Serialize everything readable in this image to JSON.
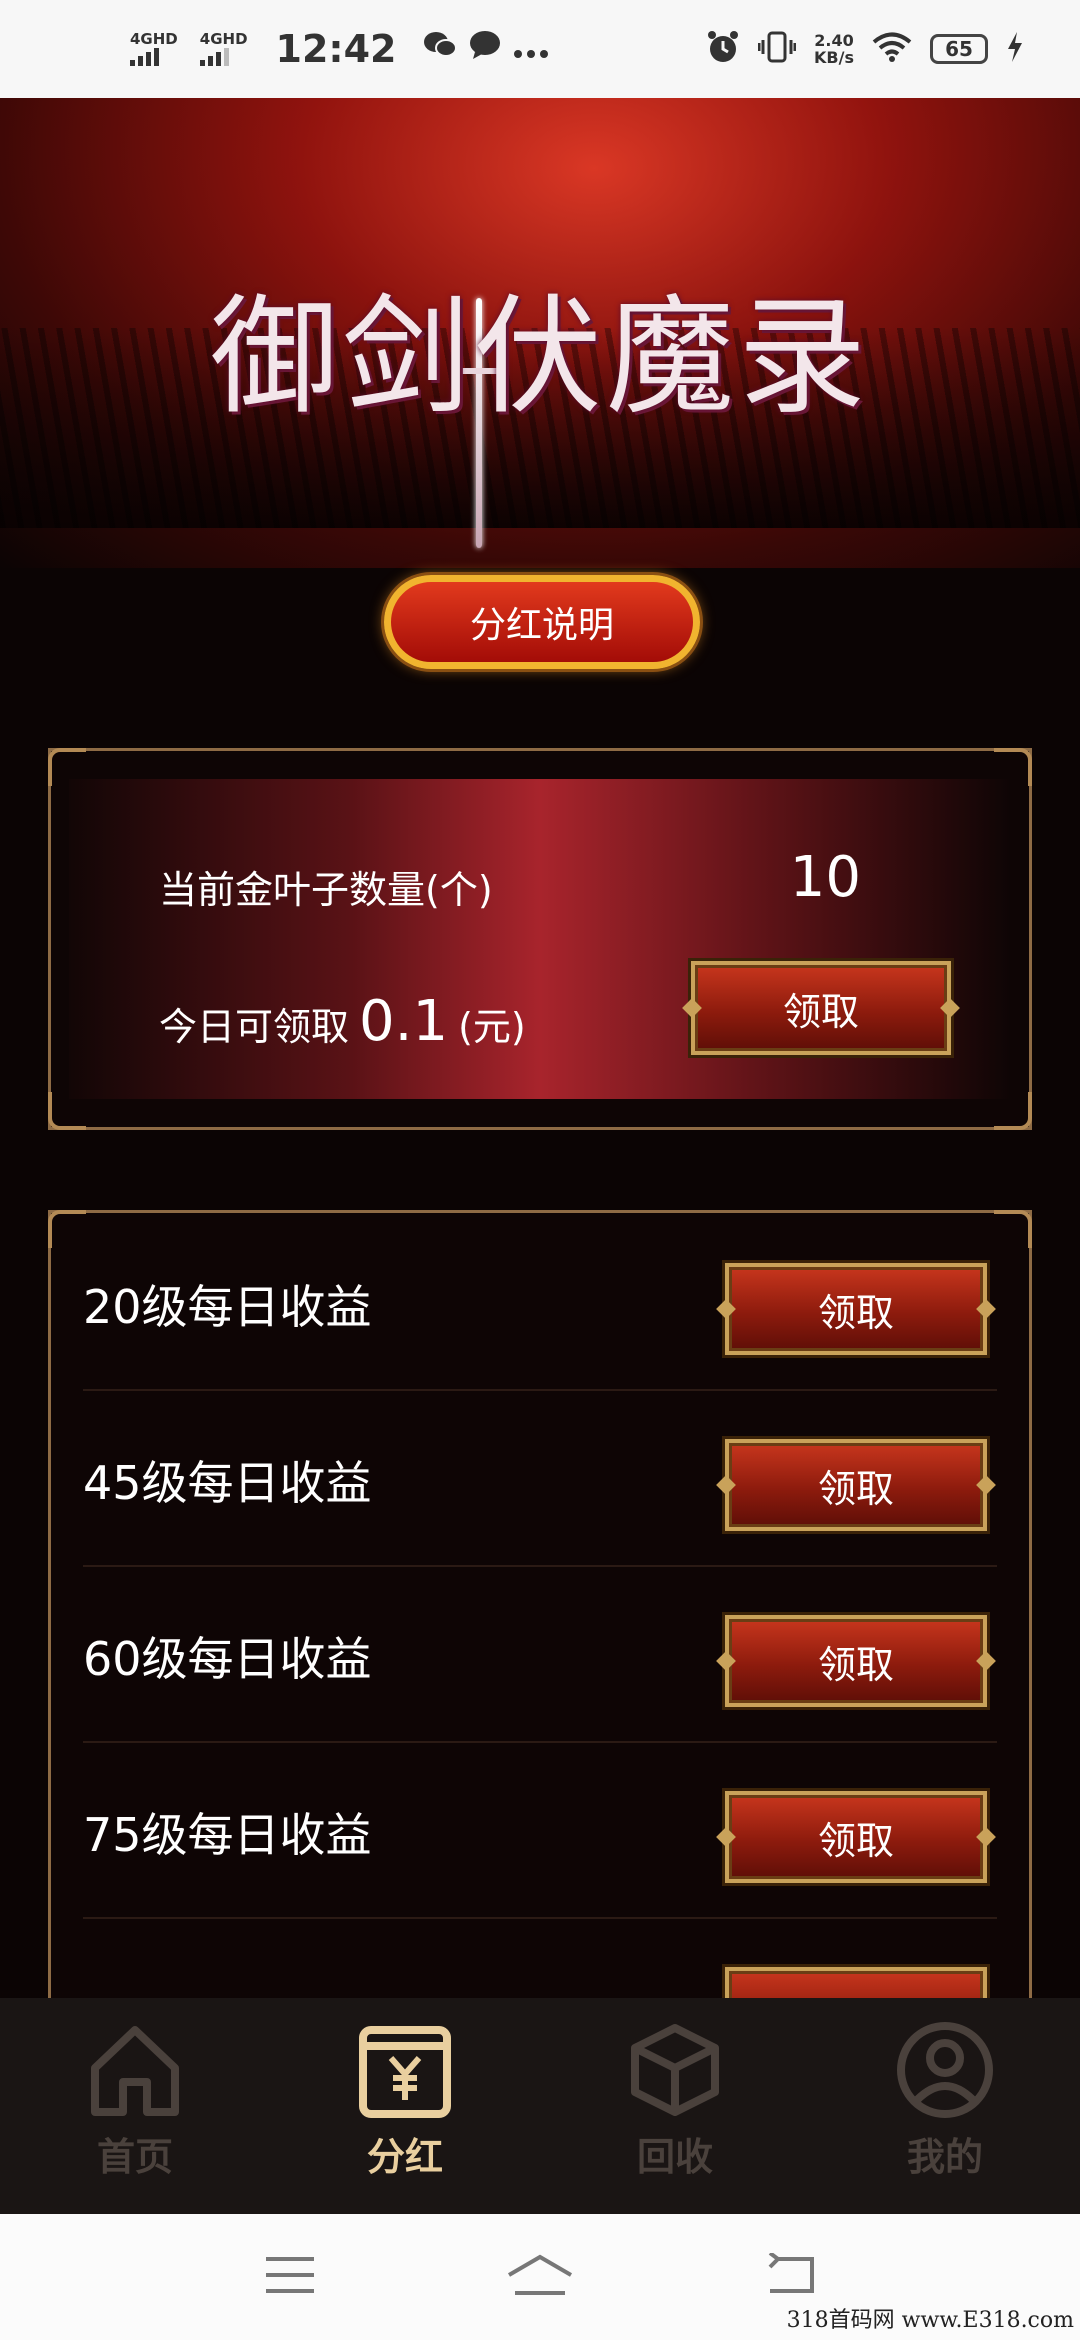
{
  "status_bar": {
    "signal1": "4GHD",
    "signal2": "4GHD",
    "time": "12:42",
    "speed_value": "2.40",
    "speed_unit": "KB/s",
    "battery": "65"
  },
  "hero": {
    "title": "御剑伏魔录",
    "explain_button": "分红说明"
  },
  "summary": {
    "leaf_label": "当前金叶子数量(个)",
    "leaf_count": "10",
    "today_label": "今日可领取",
    "today_amount": "0.1",
    "today_unit": "(元)",
    "claim_label": "领取"
  },
  "rewards": [
    {
      "label": "20级每日收益",
      "button": "领取"
    },
    {
      "label": "45级每日收益",
      "button": "领取"
    },
    {
      "label": "60级每日收益",
      "button": "领取"
    },
    {
      "label": "75级每日收益",
      "button": "领取"
    }
  ],
  "nav": {
    "items": [
      {
        "label": "首页",
        "icon": "home-icon"
      },
      {
        "label": "分红",
        "icon": "yen-card-icon"
      },
      {
        "label": "回收",
        "icon": "box-icon"
      },
      {
        "label": "我的",
        "icon": "user-icon"
      }
    ],
    "active_index": 1,
    "active_color": "#e9cf9f",
    "inactive_color": "#4a413c"
  },
  "watermark": "318首码网  www.E318.com"
}
